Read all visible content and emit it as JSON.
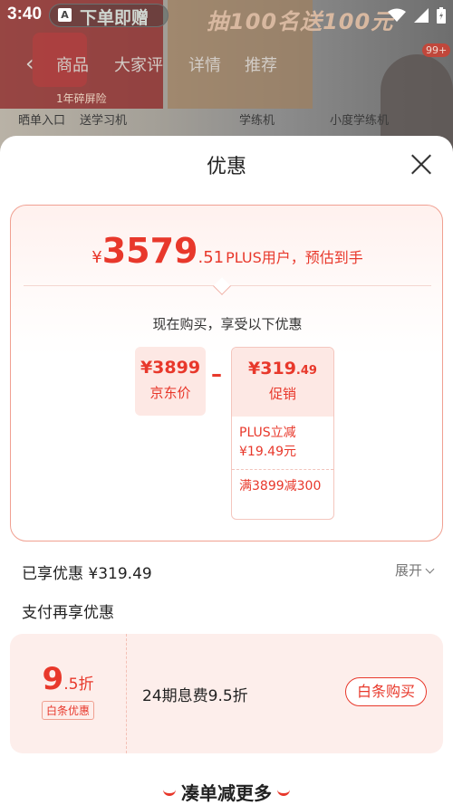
{
  "status_bar": {
    "time": "3:40",
    "notification_letter": "A"
  },
  "background": {
    "pill_text": "下单即赠",
    "promo_text": "抽100名送100元",
    "nav_tabs": [
      "商品",
      "大家评",
      "详情",
      "推荐"
    ],
    "cart_badge": "99+",
    "guarantee": "1年碎屏险",
    "row_items": [
      "晒单入口",
      "送学习机",
      "学练机",
      "小度学练机"
    ]
  },
  "sheet": {
    "title": "优惠",
    "final_price": {
      "currency": "¥",
      "integer": "3579",
      "decimal": ".51",
      "note": "PLUS用户，预估到手"
    },
    "subtitle": "现在购买，享受以下优惠",
    "jd_price": {
      "value": "¥3899",
      "label": "京东价"
    },
    "minus": "–",
    "promotion": {
      "value_main": "¥319",
      "value_dec": ".49",
      "label": "促销",
      "items": [
        "PLUS立减\n¥19.49元",
        "满3899减300"
      ]
    },
    "enjoyed": "已享优惠 ¥319.49",
    "expand_label": "展开",
    "pay_title": "支付再享优惠",
    "pay_offer": {
      "discount_main": "9",
      "discount_rest": ".5折",
      "tag": "白条优惠",
      "description": "24期息费9.5折",
      "button": "白条购买"
    },
    "more_label": "凑单减更多"
  },
  "colors": {
    "accent": "#e8382b",
    "card_bg": "#fdeeeb",
    "border": "#f0a091"
  }
}
